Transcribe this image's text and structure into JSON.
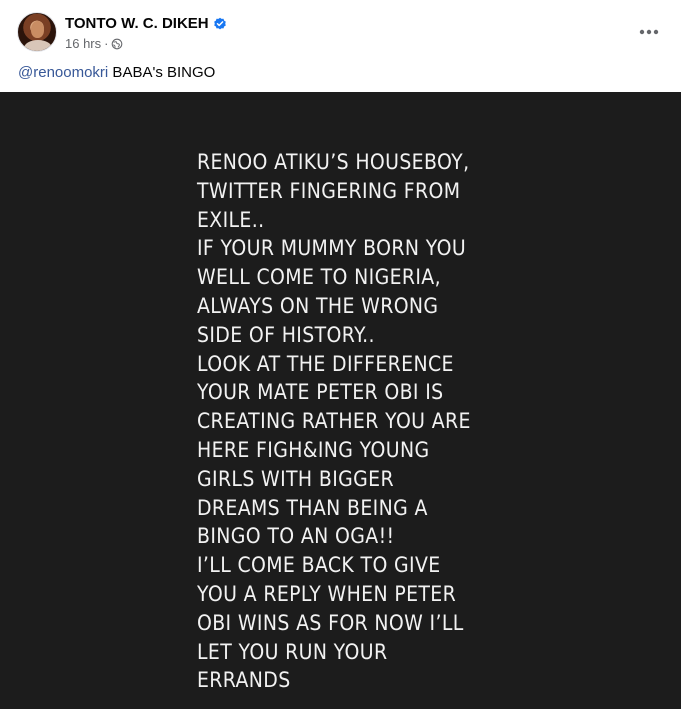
{
  "post": {
    "author": "TONTO W. C. DIKEH",
    "timestamp": "16 hrs",
    "separator": "·",
    "audience_icon": "globe-icon",
    "verified_icon": "verified-badge-icon",
    "more_icon": "more-options-icon",
    "caption": {
      "mention": "@renoomokri",
      "text": " BABA's BINGO"
    },
    "image_text": "RENOO ATIKU’S HOUSEBOY,\nTWITTER FINGERING FROM\nEXILE..\nIF YOUR MUMMY BORN YOU\nWELL COME TO NIGERIA,\nALWAYS ON THE WRONG\nSIDE OF HISTORY..\nLOOK AT THE DIFFERENCE\nYOUR MATE PETER OBI IS\nCREATING RATHER YOU ARE\nHERE FIGH&ING YOUNG\nGIRLS WITH BIGGER\nDREAMS THAN BEING A\nBINGO TO AN OGA!!\nI’LL COME BACK TO GIVE\nYOU A REPLY WHEN PETER\nOBI WINS AS FOR NOW I’LL\nLET YOU RUN YOUR\nERRANDS"
  },
  "colors": {
    "verified": "#1877f2",
    "link": "#385898",
    "meta": "#65676b",
    "image_background": "#1c1c1c",
    "image_text": "#f2f2f2"
  }
}
